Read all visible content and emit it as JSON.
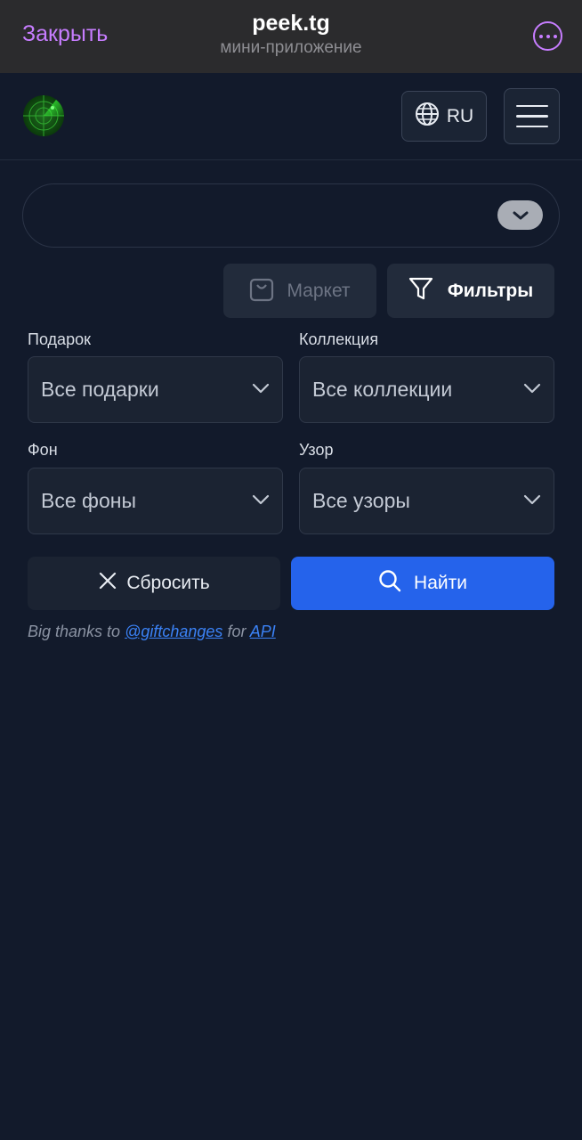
{
  "telegram_header": {
    "close_label": "Закрыть",
    "title": "peek.tg",
    "subtitle": "мини-приложение",
    "more_icon": "more-horizontal-circle-icon",
    "accent_color": "#c77dff"
  },
  "app_header": {
    "logo_icon": "radar-icon",
    "language_label": "RU",
    "language_icon": "globe-icon",
    "menu_icon": "hamburger-menu-icon"
  },
  "search": {
    "placeholder": "",
    "value": "",
    "toggle_icon": "chevron-down-icon"
  },
  "actions": {
    "market_label": "Маркет",
    "market_icon": "shopping-bag-icon",
    "filters_label": "Фильтры",
    "filters_icon": "funnel-icon"
  },
  "filters": {
    "gift": {
      "label": "Подарок",
      "value": "Все подарки"
    },
    "collection": {
      "label": "Коллекция",
      "value": "Все коллекции"
    },
    "background": {
      "label": "Фон",
      "value": "Все фоны"
    },
    "pattern": {
      "label": "Узор",
      "value": "Все узоры"
    }
  },
  "buttons": {
    "reset_label": "Сбросить",
    "reset_icon": "close-x-icon",
    "find_label": "Найти",
    "find_icon": "search-icon",
    "find_color": "#2563eb"
  },
  "credits": {
    "prefix": "Big thanks to",
    "handle": "@giftchanges",
    "middle": "for",
    "api": "API",
    "link_color": "#3b82f6"
  }
}
